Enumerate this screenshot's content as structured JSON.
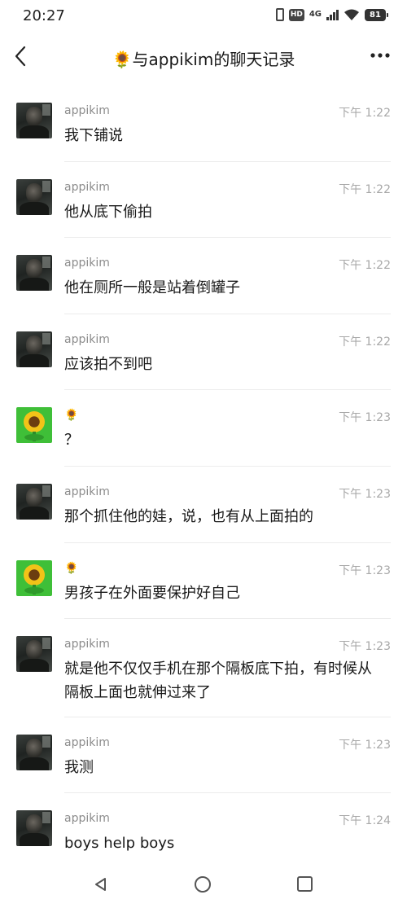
{
  "status_bar": {
    "time": "20:27",
    "network": "4G",
    "hd_badge": "HD",
    "battery": "81"
  },
  "header": {
    "back_icon": "chevron-left-icon",
    "title": "🌻与appikim的聊天记录",
    "more_icon": "more-dots-icon"
  },
  "messages": [
    {
      "sender": "appikim",
      "time": "下午 1:22",
      "text": "我下铺说",
      "avatar": "person"
    },
    {
      "sender": "appikim",
      "time": "下午 1:22",
      "text": "他从底下偷拍",
      "avatar": "person"
    },
    {
      "sender": "appikim",
      "time": "下午 1:22",
      "text": "他在厕所一般是站着倒罐子",
      "avatar": "person"
    },
    {
      "sender": "appikim",
      "time": "下午 1:22",
      "text": "应该拍不到吧",
      "avatar": "person"
    },
    {
      "sender": "🌻",
      "time": "下午 1:23",
      "text": "？",
      "avatar": "sunflower"
    },
    {
      "sender": "appikim",
      "time": "下午 1:23",
      "text": "那个抓住他的娃，说，也有从上面拍的",
      "avatar": "person"
    },
    {
      "sender": "🌻",
      "time": "下午 1:23",
      "text": "男孩子在外面要保护好自己",
      "avatar": "sunflower"
    },
    {
      "sender": "appikim",
      "time": "下午 1:23",
      "text": "就是他不仅仅手机在那个隔板底下拍，有时候从隔板上面也就伸过来了",
      "avatar": "person"
    },
    {
      "sender": "appikim",
      "time": "下午 1:23",
      "text": "我测",
      "avatar": "person"
    },
    {
      "sender": "appikim",
      "time": "下午 1:24",
      "text": "boys help boys",
      "avatar": "person"
    }
  ],
  "nav_bar": {
    "back": "triangle-back-icon",
    "home": "circle-home-icon",
    "recent": "square-recent-icon"
  },
  "colors": {
    "background": "#ffffff",
    "text": "#191919",
    "meta": "#a8a8a8",
    "separator": "#ececec"
  }
}
